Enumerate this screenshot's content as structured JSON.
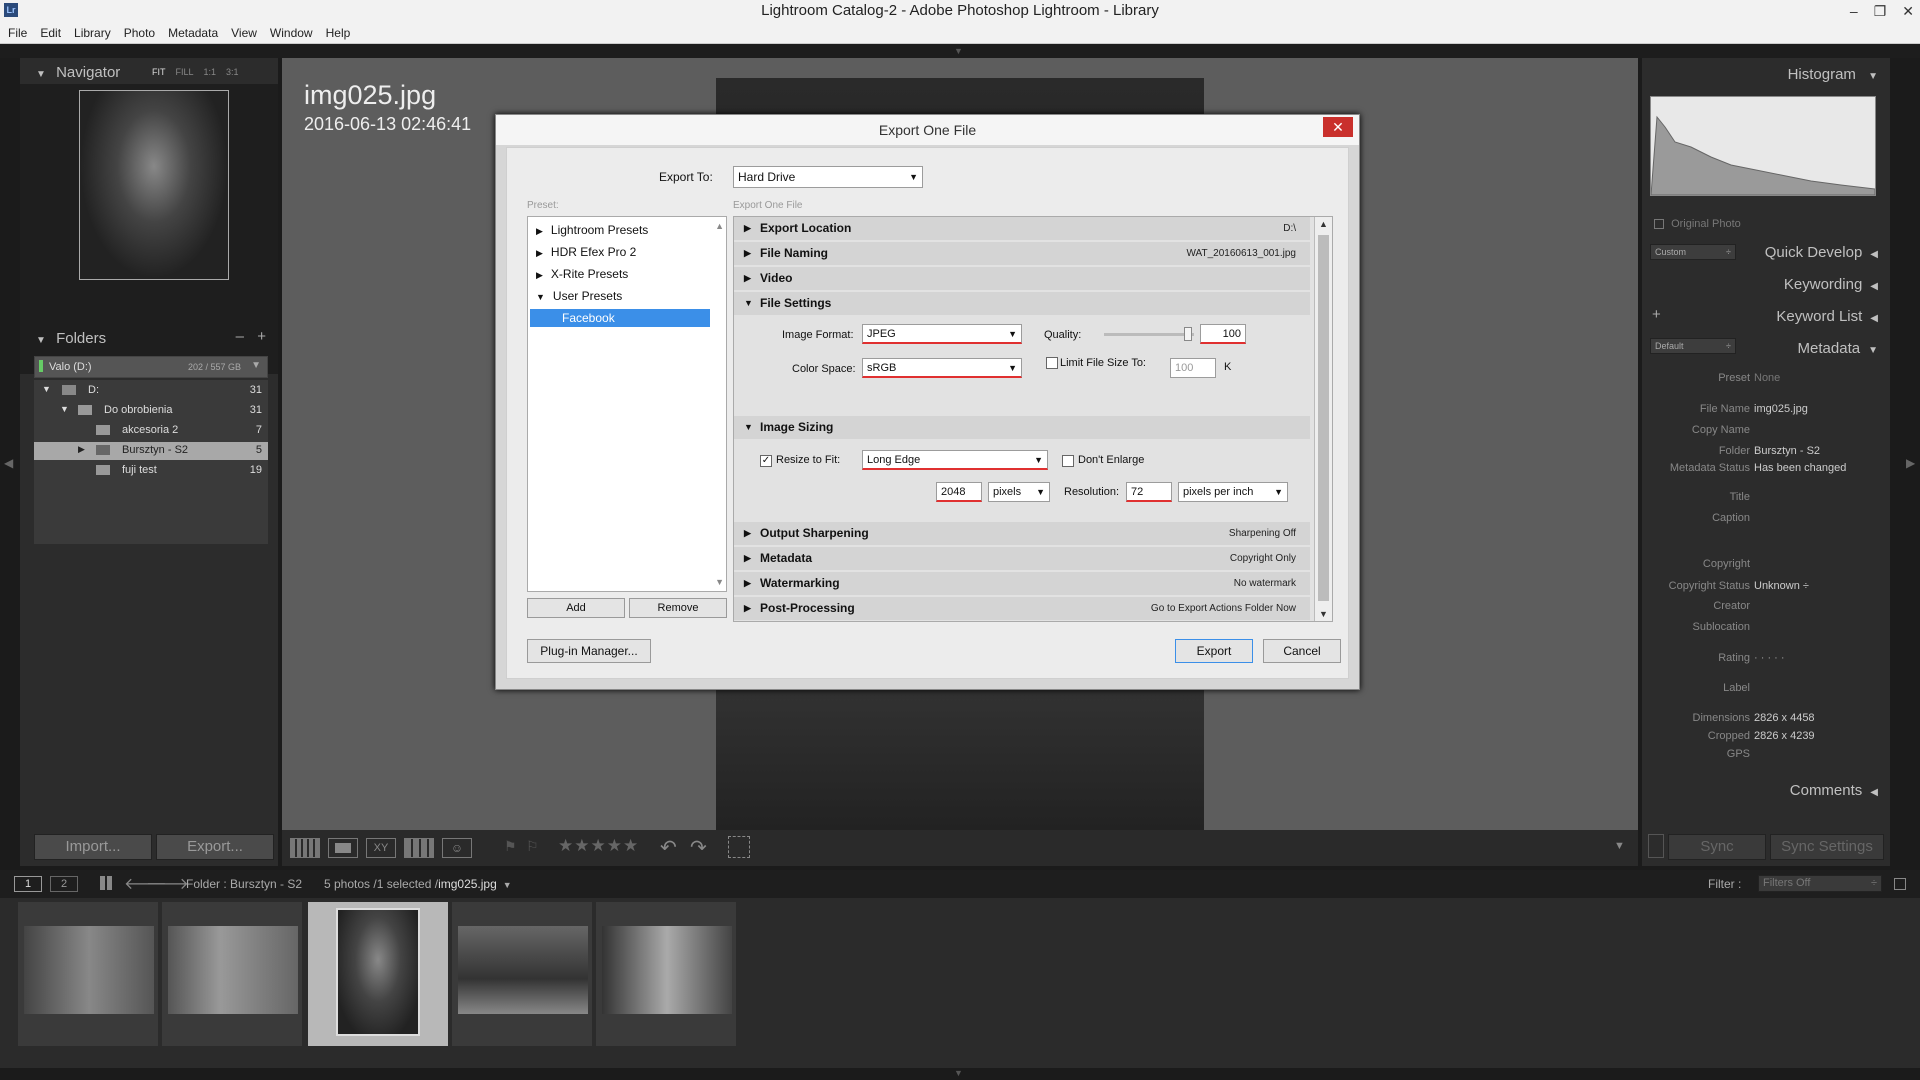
{
  "window": {
    "title": "Lightroom Catalog-2 - Adobe Photoshop Lightroom - Library",
    "app_badge": "Lr",
    "controls": [
      "–",
      "❐",
      "✕"
    ]
  },
  "menu": [
    "File",
    "Edit",
    "Library",
    "Photo",
    "Metadata",
    "View",
    "Window",
    "Help"
  ],
  "navigator": {
    "title": "Navigator",
    "zoom": [
      "FIT",
      "FILL",
      "1:1",
      "3:1"
    ]
  },
  "folders": {
    "title": "Folders",
    "volume": "Valo (D:)",
    "volume_size": "202 / 557 GB",
    "items": [
      {
        "name": "D:",
        "count": "31"
      },
      {
        "name": "Do obrobienia",
        "count": "31"
      },
      {
        "name": "akcesoria 2",
        "count": "7"
      },
      {
        "name": "Bursztyn - S2",
        "count": "5"
      },
      {
        "name": "fuji test",
        "count": "19"
      }
    ]
  },
  "left_buttons": {
    "import": "Import...",
    "export": "Export..."
  },
  "photo": {
    "filename": "img025.jpg",
    "datetime": "2016-06-13 02:46:41"
  },
  "dialog": {
    "title": "Export One File",
    "close": "✕",
    "export_to_label": "Export To:",
    "export_to_value": "Hard Drive",
    "preset_label": "Preset:",
    "section_label": "Export One File",
    "presets": [
      {
        "name": "Lightroom Presets",
        "open": false
      },
      {
        "name": "HDR Efex Pro 2",
        "open": false
      },
      {
        "name": "X-Rite Presets",
        "open": false
      },
      {
        "name": "User Presets",
        "open": true
      }
    ],
    "selected_preset": "Facebook",
    "add": "Add",
    "remove": "Remove",
    "sections": {
      "export_location": {
        "title": "Export Location",
        "summary": "D:\\"
      },
      "file_naming": {
        "title": "File Naming",
        "summary": "WAT_20160613_001.jpg"
      },
      "video": {
        "title": "Video"
      },
      "file_settings": {
        "title": "File Settings"
      },
      "image_sizing": {
        "title": "Image Sizing"
      },
      "output_sharpening": {
        "title": "Output Sharpening",
        "summary": "Sharpening Off"
      },
      "metadata": {
        "title": "Metadata",
        "summary": "Copyright Only"
      },
      "watermarking": {
        "title": "Watermarking",
        "summary": "No watermark"
      },
      "post_processing": {
        "title": "Post-Processing",
        "summary": "Go to Export Actions Folder Now"
      }
    },
    "file_settings": {
      "format_label": "Image Format:",
      "format": "JPEG",
      "quality_label": "Quality:",
      "quality": "100",
      "color_label": "Color Space:",
      "color": "sRGB",
      "limit_label": "Limit File Size To:",
      "limit_value": "100",
      "limit_unit": "K"
    },
    "image_sizing": {
      "resize_label": "Resize to Fit:",
      "resize_mode": "Long Edge",
      "dont_enlarge": "Don't Enlarge",
      "size": "2048",
      "size_unit": "pixels",
      "resolution_label": "Resolution:",
      "resolution": "72",
      "resolution_unit": "pixels per inch"
    },
    "plugin_manager": "Plug-in Manager...",
    "export": "Export",
    "cancel": "Cancel"
  },
  "right": {
    "histogram": "Histogram",
    "original_photo": "Original Photo",
    "quick_develop": "Quick Develop",
    "qd_preset": "Custom",
    "keywording": "Keywording",
    "keyword_list": "Keyword List",
    "metadata": "Metadata",
    "meta_preset": "Default",
    "fields": [
      {
        "k": "Preset",
        "v": "None"
      },
      {
        "k": "File Name",
        "v": "img025.jpg"
      },
      {
        "k": "Copy Name",
        "v": ""
      },
      {
        "k": "Folder",
        "v": "Bursztyn - S2"
      },
      {
        "k": "Metadata Status",
        "v": "Has been changed"
      },
      {
        "k": "Title",
        "v": ""
      },
      {
        "k": "Caption",
        "v": ""
      },
      {
        "k": "Copyright",
        "v": ""
      },
      {
        "k": "Copyright Status",
        "v": "Unknown ÷"
      },
      {
        "k": "Creator",
        "v": ""
      },
      {
        "k": "Sublocation",
        "v": ""
      },
      {
        "k": "Rating",
        "v": "·  ·  ·  ·  ·"
      },
      {
        "k": "Label",
        "v": ""
      },
      {
        "k": "Dimensions",
        "v": "2826 x 4458"
      },
      {
        "k": "Cropped",
        "v": "2826 x 4239"
      },
      {
        "k": "GPS",
        "v": ""
      }
    ],
    "comments": "Comments",
    "sync": "Sync",
    "sync_settings": "Sync Settings"
  },
  "filmbar": {
    "page1": "1",
    "page2": "2",
    "source": "Folder : Bursztyn - S2",
    "count": "5 photos /1 selected /",
    "current": "img025.jpg",
    "filter_label": "Filter :",
    "filter_value": "Filters Off"
  },
  "toolbar": {
    "stars": "★★★★★"
  },
  "colors": {
    "accent_selection": "#3b8fe8",
    "red_underline": "#e03030",
    "close_red": "#c9302c"
  }
}
